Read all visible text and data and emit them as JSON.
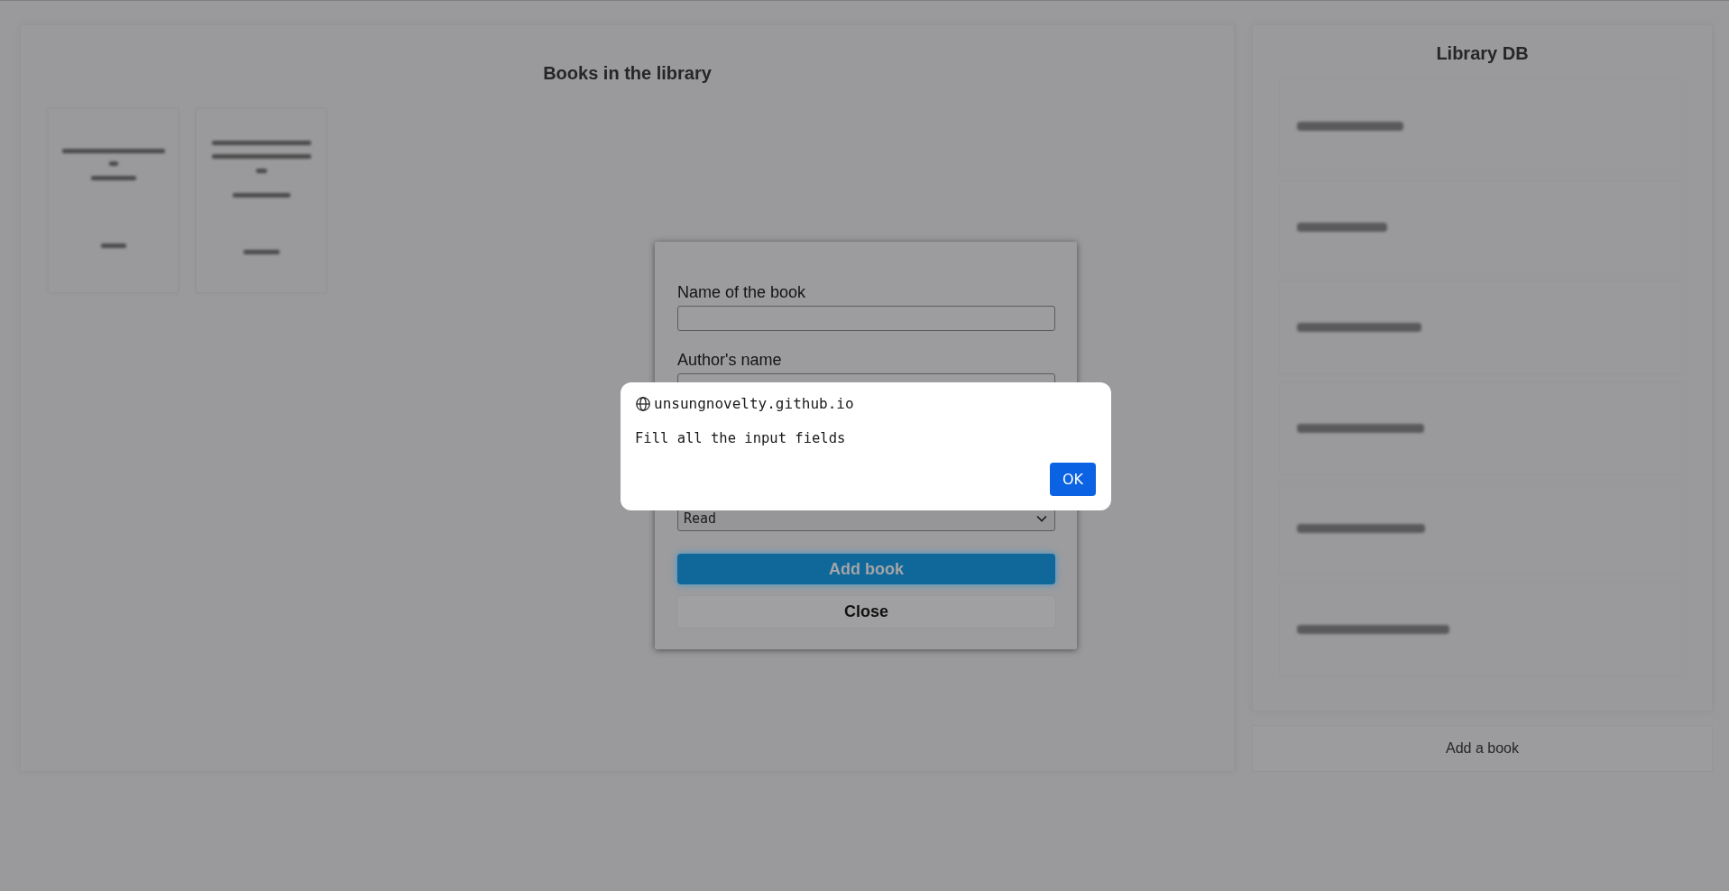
{
  "library": {
    "title": "Books in the library"
  },
  "stats_panel": {
    "title": "Library DB"
  },
  "add_book_button": "Add a book",
  "book_form": {
    "fields": [
      {
        "kind": "text",
        "label": "Name of the book"
      },
      {
        "kind": "text",
        "label": "Author's name"
      },
      {
        "kind": "select",
        "value": "Read"
      }
    ],
    "buttons": [
      {
        "kind": "primary",
        "label": "Add book",
        "focused": true
      },
      {
        "kind": "secondary",
        "label": "Close",
        "focused": false
      }
    ]
  },
  "alert": {
    "origin": "unsungnovelty.github.io",
    "message": "Fill all the input fields",
    "button": "OK"
  }
}
